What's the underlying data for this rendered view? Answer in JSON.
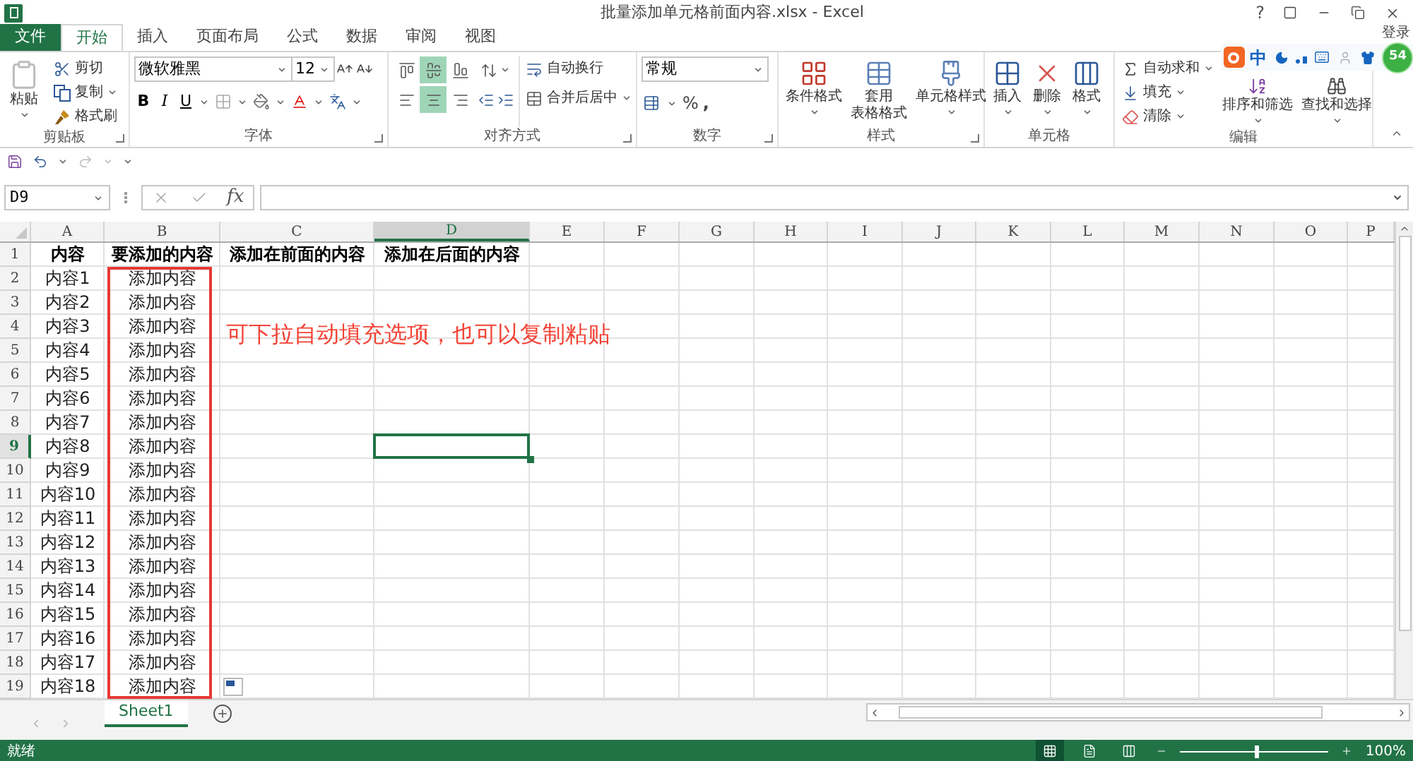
{
  "window": {
    "title": "批量添加单元格前面内容.xlsx - Excel",
    "help": "?",
    "sign_in": "登录"
  },
  "ribbon_tabs": [
    {
      "label": "文件",
      "kind": "file",
      "selected": false
    },
    {
      "label": "开始",
      "kind": "tab",
      "selected": true
    },
    {
      "label": "插入",
      "kind": "tab",
      "selected": false
    },
    {
      "label": "页面布局",
      "kind": "tab",
      "selected": false
    },
    {
      "label": "公式",
      "kind": "tab",
      "selected": false
    },
    {
      "label": "数据",
      "kind": "tab",
      "selected": false
    },
    {
      "label": "审阅",
      "kind": "tab",
      "selected": false
    },
    {
      "label": "视图",
      "kind": "tab",
      "selected": false
    }
  ],
  "ribbon": {
    "clipboard": {
      "label": "剪贴板",
      "paste": "粘贴",
      "cut": "剪切",
      "copy": "复制",
      "format_painter": "格式刷"
    },
    "font": {
      "label": "字体",
      "font_name": "微软雅黑",
      "font_size": "12",
      "bold": "B",
      "italic": "I",
      "underline": "U"
    },
    "alignment": {
      "label": "对齐方式",
      "vertical": [
        {
          "kind": "top",
          "selected": false
        },
        {
          "kind": "middle",
          "selected": true
        },
        {
          "kind": "bottom",
          "selected": false
        }
      ],
      "horizontal": [
        {
          "kind": "left",
          "selected": false
        },
        {
          "kind": "center",
          "selected": true
        },
        {
          "kind": "right",
          "selected": false
        }
      ],
      "wrap_text": "自动换行",
      "merge_center": "合并后居中"
    },
    "number": {
      "label": "数字",
      "format": "常规",
      "percent": "%",
      "comma": ","
    },
    "styles": {
      "label": "样式",
      "conditional": "条件格式",
      "table_format": [
        "套用",
        "表格格式"
      ],
      "cell_styles": "单元格样式"
    },
    "cells": {
      "label": "单元格",
      "insert": "插入",
      "delete": "删除",
      "format": "格式"
    },
    "editing": {
      "label": "编辑",
      "autosum": "自动求和",
      "fill": "填充",
      "clear": "清除",
      "sort_filter": "排序和筛选",
      "find_select": "查找和选择"
    }
  },
  "ime_toolbar": {
    "language": "中",
    "badge": "54"
  },
  "formula_bar": {
    "name_box": "D9",
    "function_label": "fx"
  },
  "columns": [
    {
      "label": "A",
      "selected": false
    },
    {
      "label": "B",
      "selected": false
    },
    {
      "label": "C",
      "selected": false
    },
    {
      "label": "D",
      "selected": true
    },
    {
      "label": "E",
      "selected": false
    },
    {
      "label": "F",
      "selected": false
    },
    {
      "label": "G",
      "selected": false
    },
    {
      "label": "H",
      "selected": false
    },
    {
      "label": "I",
      "selected": false
    },
    {
      "label": "J",
      "selected": false
    },
    {
      "label": "K",
      "selected": false
    },
    {
      "label": "L",
      "selected": false
    },
    {
      "label": "M",
      "selected": false
    },
    {
      "label": "N",
      "selected": false
    },
    {
      "label": "O",
      "selected": false
    },
    {
      "label": "P",
      "selected": false
    }
  ],
  "rows": [
    {
      "number": "1",
      "kind": "header",
      "selected": false,
      "cells": [
        "内容",
        "要添加的内容",
        "添加在前面的内容",
        "添加在后面的内容"
      ]
    },
    {
      "number": "2",
      "kind": "data",
      "selected": false,
      "cells": [
        "内容1",
        "添加内容"
      ]
    },
    {
      "number": "3",
      "kind": "data",
      "selected": false,
      "cells": [
        "内容2",
        "添加内容"
      ]
    },
    {
      "number": "4",
      "kind": "data",
      "selected": false,
      "cells": [
        "内容3",
        "添加内容"
      ]
    },
    {
      "number": "5",
      "kind": "data",
      "selected": false,
      "cells": [
        "内容4",
        "添加内容"
      ]
    },
    {
      "number": "6",
      "kind": "data",
      "selected": false,
      "cells": [
        "内容5",
        "添加内容"
      ]
    },
    {
      "number": "7",
      "kind": "data",
      "selected": false,
      "cells": [
        "内容6",
        "添加内容"
      ]
    },
    {
      "number": "8",
      "kind": "data",
      "selected": false,
      "cells": [
        "内容7",
        "添加内容"
      ]
    },
    {
      "number": "9",
      "kind": "data",
      "selected": true,
      "cells": [
        "内容8",
        "添加内容"
      ]
    },
    {
      "number": "10",
      "kind": "data",
      "selected": false,
      "cells": [
        "内容9",
        "添加内容"
      ]
    },
    {
      "number": "11",
      "kind": "data",
      "selected": false,
      "cells": [
        "内容10",
        "添加内容"
      ]
    },
    {
      "number": "12",
      "kind": "data",
      "selected": false,
      "cells": [
        "内容11",
        "添加内容"
      ]
    },
    {
      "number": "13",
      "kind": "data",
      "selected": false,
      "cells": [
        "内容12",
        "添加内容"
      ]
    },
    {
      "number": "14",
      "kind": "data",
      "selected": false,
      "cells": [
        "内容13",
        "添加内容"
      ]
    },
    {
      "number": "15",
      "kind": "data",
      "selected": false,
      "cells": [
        "内容14",
        "添加内容"
      ]
    },
    {
      "number": "16",
      "kind": "data",
      "selected": false,
      "cells": [
        "内容15",
        "添加内容"
      ]
    },
    {
      "number": "17",
      "kind": "data",
      "selected": false,
      "cells": [
        "内容16",
        "添加内容"
      ]
    },
    {
      "number": "18",
      "kind": "data",
      "selected": false,
      "cells": [
        "内容17",
        "添加内容"
      ]
    },
    {
      "number": "19",
      "kind": "data",
      "selected": false,
      "cells": [
        "内容18",
        "添加内容"
      ]
    }
  ],
  "annotation": "可下拉自动填充选项，也可以复制粘贴",
  "sheet_tabs": [
    {
      "label": "Sheet1",
      "selected": true
    }
  ],
  "status_bar": {
    "status": "就绪",
    "zoom": "100%",
    "zoom_slider": {
      "level": 0.5
    },
    "views": [
      {
        "kind": "normal",
        "selected": true
      },
      {
        "kind": "page_layout",
        "selected": false
      },
      {
        "kind": "page_break",
        "selected": false
      }
    ]
  }
}
